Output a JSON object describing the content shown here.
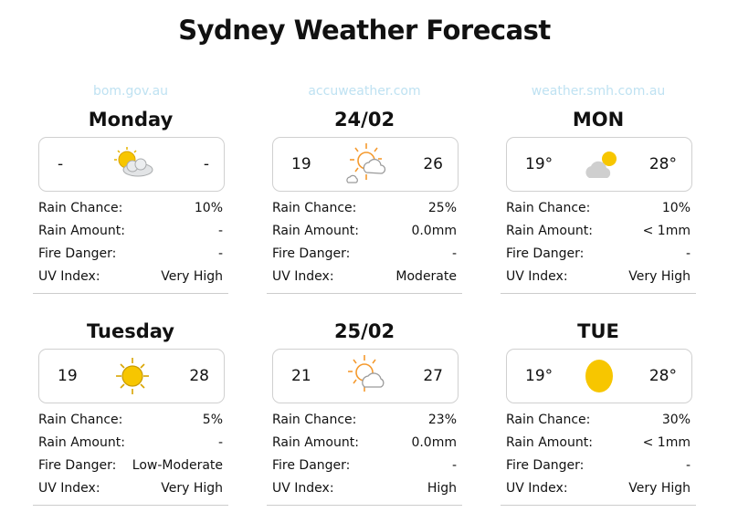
{
  "title": "Sydney Weather Forecast",
  "columns": [
    {
      "source": "bom.gov.au",
      "days": [
        {
          "label": "Monday",
          "min": "-",
          "max": "-",
          "icon": "partly-cloudy-icon",
          "rain_chance": "10%",
          "rain_amount": "-",
          "fire_danger": "-",
          "uv_index": "Very High"
        },
        {
          "label": "Tuesday",
          "min": "19",
          "max": "28",
          "icon": "sunny-icon",
          "rain_chance": "5%",
          "rain_amount": "-",
          "fire_danger": "Low-Moderate",
          "uv_index": "Very High"
        }
      ]
    },
    {
      "source": "accuweather.com",
      "days": [
        {
          "label": "24/02",
          "min": "19",
          "max": "26",
          "icon": "sun-cloud-outline-icon",
          "rain_chance": "25%",
          "rain_amount": "0.0mm",
          "fire_danger": "-",
          "uv_index": "Moderate"
        },
        {
          "label": "25/02",
          "min": "21",
          "max": "27",
          "icon": "sun-cloud-outline-icon",
          "rain_chance": "23%",
          "rain_amount": "0.0mm",
          "fire_danger": "-",
          "uv_index": "High"
        }
      ]
    },
    {
      "source": "weather.smh.com.au",
      "days": [
        {
          "label": "MON",
          "min": "19°",
          "max": "28°",
          "icon": "cloud-sun-icon",
          "rain_chance": "10%",
          "rain_amount": "< 1mm",
          "fire_danger": "-",
          "uv_index": "Very High"
        },
        {
          "label": "TUE",
          "min": "19°",
          "max": "28°",
          "icon": "sun-icon",
          "rain_chance": "30%",
          "rain_amount": "< 1mm",
          "fire_danger": "-",
          "uv_index": "Very High"
        }
      ]
    }
  ],
  "labels": {
    "rain_chance": "Rain Chance:",
    "rain_amount": "Rain Amount:",
    "fire_danger": "Fire Danger:",
    "uv_index": "UV Index:"
  },
  "colors": {
    "source_link": "#bfe2f2",
    "sun_yellow": "#f7c600",
    "sun_orange": "#f59a2e",
    "cloud_grey": "#cfcfcf"
  }
}
